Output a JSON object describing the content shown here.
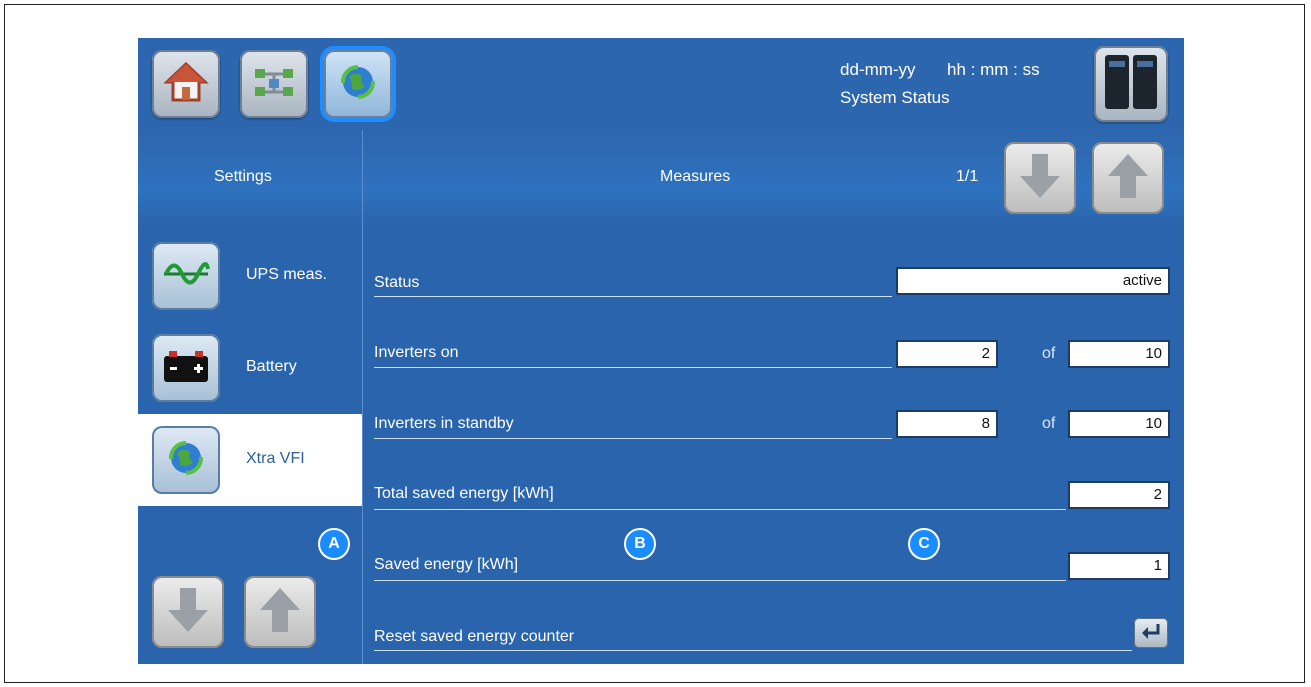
{
  "header": {
    "date_format": "dd-mm-yy",
    "time_format": "hh : mm : ss",
    "status_title": "System Status",
    "icons": [
      "home-icon",
      "network-icon",
      "globe-icon",
      "ups-cabinet-icon"
    ]
  },
  "subheader": {
    "settings_label": "Settings",
    "measures_label": "Measures",
    "page_indicator": "1/1"
  },
  "sidebar": {
    "items": [
      {
        "label": "UPS meas.",
        "icon": "sine-wave-icon",
        "selected": false
      },
      {
        "label": "Battery",
        "icon": "battery-icon",
        "selected": false
      },
      {
        "label": "Xtra VFI",
        "icon": "globe-icon",
        "selected": true
      }
    ]
  },
  "measures": {
    "status_label": "Status",
    "status_value": "active",
    "inverters_on_label": "Inverters on",
    "inverters_on_value": "2",
    "inverters_on_total": "10",
    "inverters_standby_label": "Inverters in standby",
    "inverters_standby_value": "8",
    "inverters_standby_total": "10",
    "of_label": "of",
    "total_saved_label": "Total saved energy [kWh]",
    "total_saved_value": "2",
    "saved_label": "Saved energy [kWh]",
    "saved_value": "1",
    "reset_label": "Reset saved energy counter"
  },
  "markers": [
    "A",
    "B",
    "C"
  ],
  "colors": {
    "background": "#2a64ad",
    "selected_item": "#ffffff",
    "marker": "#1b8cff"
  }
}
